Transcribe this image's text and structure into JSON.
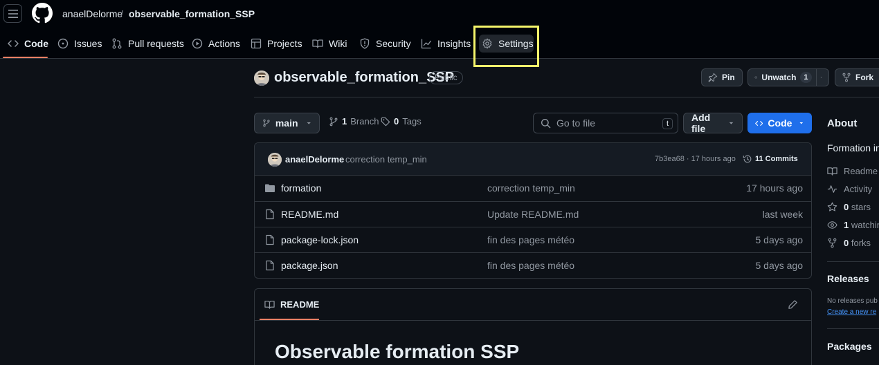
{
  "header": {
    "owner": "anaelDelorme",
    "separator": "/",
    "repo": "observable_formation_SSP"
  },
  "nav": {
    "tabs": [
      {
        "label": "Code",
        "icon": "code-icon"
      },
      {
        "label": "Issues",
        "icon": "issue-icon"
      },
      {
        "label": "Pull requests",
        "icon": "pull-request-icon"
      },
      {
        "label": "Actions",
        "icon": "play-icon"
      },
      {
        "label": "Projects",
        "icon": "table-icon"
      },
      {
        "label": "Wiki",
        "icon": "book-icon"
      },
      {
        "label": "Security",
        "icon": "shield-icon"
      },
      {
        "label": "Insights",
        "icon": "graph-icon"
      },
      {
        "label": "Settings",
        "icon": "gear-icon"
      }
    ]
  },
  "repo_head": {
    "title": "observable_formation_SSP",
    "visibility": "Public",
    "pin": "Pin",
    "unwatch": "Unwatch",
    "watch_count": "1",
    "fork": "Fork"
  },
  "branch_bar": {
    "branch": "main",
    "branch_count": "1",
    "branch_label": "Branch",
    "tag_count": "0",
    "tag_label": "Tags",
    "search_placeholder": "Go to file",
    "search_key": "t",
    "add_file": "Add file",
    "code": "Code"
  },
  "commit": {
    "author": "anaelDelorme",
    "message": "correction temp_min",
    "hash_time": "7b3ea68 · 17 hours ago",
    "commits": "11 Commits"
  },
  "files": [
    {
      "name": "formation",
      "type": "folder",
      "message": "correction temp_min",
      "date": "17 hours ago"
    },
    {
      "name": "README.md",
      "type": "file",
      "message": "Update README.md",
      "date": "last week"
    },
    {
      "name": "package-lock.json",
      "type": "file",
      "message": "fin des pages météo",
      "date": "5 days ago"
    },
    {
      "name": "package.json",
      "type": "file",
      "message": "fin des pages météo",
      "date": "5 days ago"
    }
  ],
  "readme": {
    "tab": "README",
    "heading": "Observable formation SSP"
  },
  "sidebar": {
    "about": "About",
    "description": "Formation in",
    "readme": "Readme",
    "activity": "Activity",
    "stars_count": "0",
    "stars": "stars",
    "watching_count": "1",
    "watching": "watching",
    "forks_count": "0",
    "forks": "forks",
    "releases": "Releases",
    "no_releases": "No releases pub",
    "create_release": "Create a new re",
    "packages": "Packages"
  },
  "colors": {
    "accent_underline": "#f78166",
    "highlight_box": "#f5f56b",
    "primary_button": "#1f6feb",
    "link": "#4493f8"
  }
}
